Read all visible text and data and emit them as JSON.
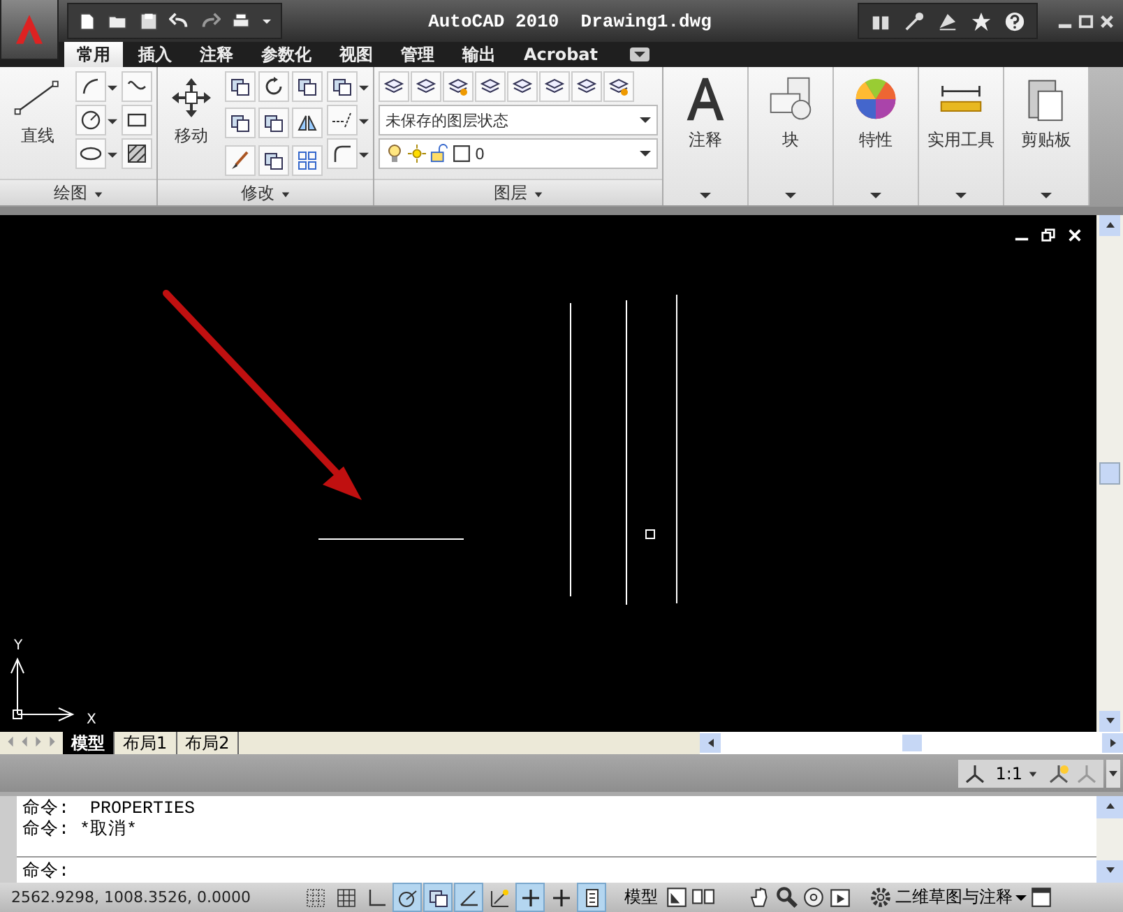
{
  "window": {
    "title": "AutoCAD 2010  Drawing1.dwg"
  },
  "tabs": [
    {
      "label": "常用",
      "selected": true
    },
    {
      "label": "插入",
      "selected": false
    },
    {
      "label": "注释",
      "selected": false
    },
    {
      "label": "参数化",
      "selected": false
    },
    {
      "label": "视图",
      "selected": false
    },
    {
      "label": "管理",
      "selected": false
    },
    {
      "label": "输出",
      "selected": false
    },
    {
      "label": "Acrobat",
      "selected": false
    }
  ],
  "ribbon": {
    "draw_panel": {
      "title": "绘图",
      "big_button": "直线"
    },
    "modify_panel": {
      "title": "修改",
      "big_button": "移动"
    },
    "layers_panel": {
      "title": "图层",
      "layer_state": "未保存的图层状态",
      "current_layer": "0"
    },
    "big_panels": [
      {
        "kind": "text",
        "label": "注释"
      },
      {
        "kind": "block",
        "label": "块"
      },
      {
        "kind": "palette",
        "label": "特性"
      },
      {
        "kind": "ruler",
        "label": "实用工具"
      },
      {
        "kind": "clipboard",
        "label": "剪贴板"
      }
    ]
  },
  "drawing": {
    "ucs": {
      "y_label": "Y",
      "x_label": "X"
    }
  },
  "layout_tabs": [
    {
      "label": "模型",
      "selected": true
    },
    {
      "label": "布局1",
      "selected": false
    },
    {
      "label": "布局2",
      "selected": false
    }
  ],
  "annotation_scale": "1:1",
  "command_history": [
    "命令:  PROPERTIES",
    "命令: *取消*"
  ],
  "command_prompt": "命令:",
  "status_bar": {
    "coordinates": "2562.9298, 1008.3526, 0.0000",
    "toggles": [
      {
        "on": false
      },
      {
        "on": false
      },
      {
        "on": false
      },
      {
        "on": true
      },
      {
        "on": true
      },
      {
        "on": true
      },
      {
        "on": false
      },
      {
        "on": true
      },
      {
        "on": false
      },
      {
        "on": true
      }
    ],
    "model_button": "模型",
    "workspace": "二维草图与注释"
  }
}
